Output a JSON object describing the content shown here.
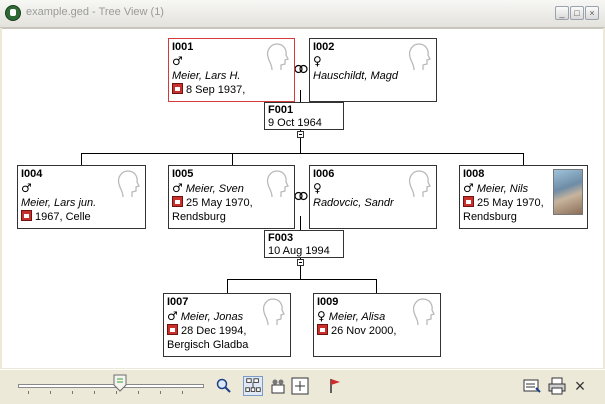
{
  "window": {
    "title": "example.ged - Tree View (1)",
    "buttons": {
      "minimize": "_",
      "maximize": "□",
      "close": "×"
    }
  },
  "tree": {
    "persons": [
      {
        "id": "I001",
        "sex": "♂",
        "name": "Meier, Lars H.",
        "date": "8 Sep 1937,",
        "place": "",
        "selected": true,
        "has_photo": false
      },
      {
        "id": "I002",
        "sex": "♀",
        "name": "Hauschildt, Magd",
        "date": "",
        "place": "",
        "selected": false,
        "has_photo": false
      },
      {
        "id": "I004",
        "sex": "♂",
        "name": "Meier, Lars jun.",
        "date": "1967, Celle",
        "place": "",
        "selected": false,
        "has_photo": false
      },
      {
        "id": "I005",
        "sex": "♂",
        "name": "Meier, Sven",
        "date": "25 May 1970,",
        "place": "Rendsburg",
        "selected": false,
        "has_photo": false
      },
      {
        "id": "I006",
        "sex": "♀",
        "name": "Radovcic, Sandr",
        "date": "",
        "place": "",
        "selected": false,
        "has_photo": false
      },
      {
        "id": "I008",
        "sex": "♂",
        "name": "Meier, Nils",
        "date": "25 May 1970,",
        "place": "Rendsburg",
        "selected": false,
        "has_photo": true
      },
      {
        "id": "I007",
        "sex": "♂",
        "name": "Meier, Jonas",
        "date": "28 Dec 1994,",
        "place": "Bergisch Gladba",
        "selected": false,
        "has_photo": false
      },
      {
        "id": "I009",
        "sex": "♀",
        "name": "Meier, Alisa",
        "date": "26 Nov 2000,",
        "place": "",
        "selected": false,
        "has_photo": false
      }
    ],
    "families": [
      {
        "id": "F001",
        "date": "9 Oct 1964"
      },
      {
        "id": "F003",
        "date": "10 Aug 1994"
      }
    ]
  },
  "toolbar": {
    "zoom_level_fraction": 0.55,
    "icons": [
      "zoom-icon",
      "tree-layout-icon",
      "family-icon",
      "fit-window-icon",
      "bookmark-flag-icon",
      "settings-icon",
      "print-icon",
      "close-icon"
    ],
    "close_label": "×"
  },
  "colors": {
    "selected_border": "#d53a3a",
    "event_icon": "#c9302c"
  }
}
